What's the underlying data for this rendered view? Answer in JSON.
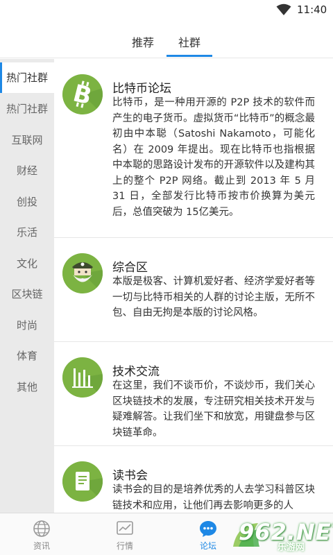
{
  "status_bar": {
    "time": "11:40",
    "wifi_icon": "wifi-icon"
  },
  "top_tabs": [
    {
      "label": "推荐",
      "active": false
    },
    {
      "label": "社群",
      "active": true
    }
  ],
  "sidebar": {
    "items": [
      {
        "label": "热门社群",
        "active": true
      },
      {
        "label": "热门社群",
        "active": false
      },
      {
        "label": "互联网",
        "active": false
      },
      {
        "label": "财经",
        "active": false
      },
      {
        "label": "创投",
        "active": false
      },
      {
        "label": "乐活",
        "active": false
      },
      {
        "label": "文化",
        "active": false
      },
      {
        "label": "区块链",
        "active": false
      },
      {
        "label": "时尚",
        "active": false
      },
      {
        "label": "体育",
        "active": false
      },
      {
        "label": "其他",
        "active": false
      }
    ]
  },
  "forums": [
    {
      "title": "比特币论坛",
      "icon": "bitcoin-icon",
      "description": "比特币，是一种用开源的 P2P 技术的软件而产生的电子货币。虚拟货币“比特币”的概念最初由中本聪（Satoshi Nakamoto，可能化名）在 2009 年提出。现在比特币也指根据中本聪的思路设计发布的开源软件以及建构其上的整个 P2P 网络。截止到 2013 年 5 月 31 日，全部发行比特币按市价换算为美元后，总值突破为 15亿美元。"
    },
    {
      "title": "综合区",
      "icon": "pirate-avatar-icon",
      "description": "本版是极客、计算机爱好者、经济学爱好者等一切与比特币相关的人群的讨论主版，无所不包、自由无拘是本版的讨论风格。"
    },
    {
      "title": "技术交流",
      "icon": "bar-chart-icon",
      "description": "在这里，我们不谈币价，不谈炒币，我们关心区块链技术的发展，专注研究相关技术开发与疑难解答。让我们坐下和放宽，用键盘参与区块链革命。"
    },
    {
      "title": "读书会",
      "icon": "document-icon",
      "description": "读书会的目的是培养优秀的人去学习科普区块链技术和应用，让他们再去影响更多的人"
    }
  ],
  "bottom_nav": [
    {
      "label": "资讯",
      "icon": "globe-icon",
      "active": false
    },
    {
      "label": "行情",
      "icon": "chart-icon",
      "active": false
    },
    {
      "label": "论坛",
      "icon": "chat-icon",
      "active": true
    },
    {
      "label": "",
      "icon": "",
      "active": false
    }
  ],
  "watermark": {
    "brand": "962.NET",
    "sub": "乐游网"
  },
  "colors": {
    "accent": "#1e88e5",
    "icon_green": "#7cb342",
    "sidebar_bg": "#eaeaea"
  }
}
